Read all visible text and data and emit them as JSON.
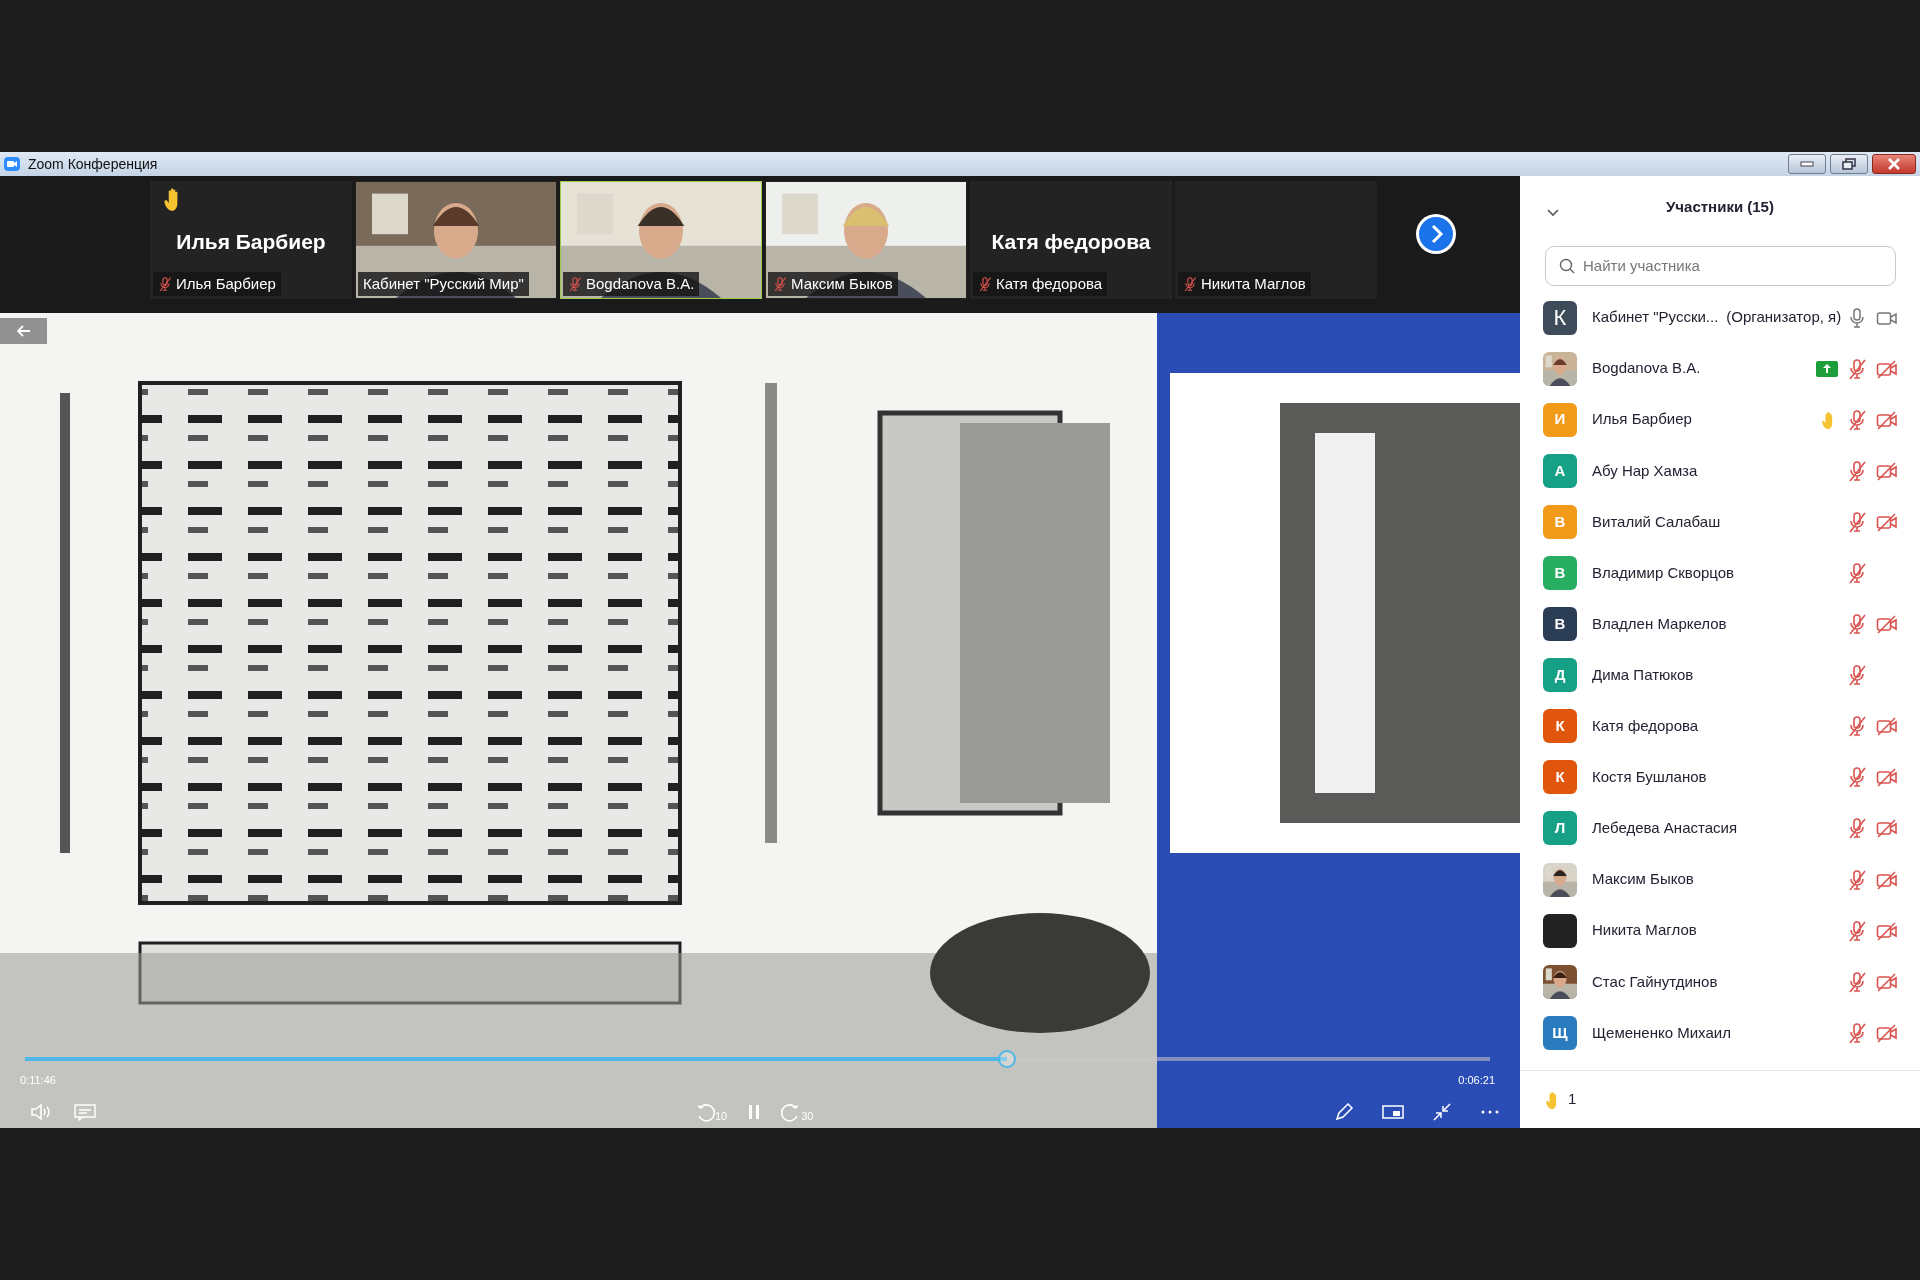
{
  "window": {
    "title": "Zoom Конференция"
  },
  "thumbnails": [
    {
      "kind": "name",
      "name": "Илья Барбиер",
      "label": "Илья Барбиер",
      "muted": true,
      "hand": true,
      "highlighted": false
    },
    {
      "kind": "video",
      "label": "Кабинет \"Русский Мир\"",
      "muted": false,
      "hand": false,
      "highlighted": false
    },
    {
      "kind": "video",
      "label": "Bogdanova B.A.",
      "muted": true,
      "hand": false,
      "highlighted": true
    },
    {
      "kind": "video",
      "label": "Максим Быков",
      "muted": true,
      "hand": false,
      "highlighted": false
    },
    {
      "kind": "name",
      "name": "Катя федорова",
      "label": "Катя федорова",
      "muted": true,
      "hand": false,
      "highlighted": false
    },
    {
      "kind": "name",
      "label": "Никита Маглов",
      "muted": true,
      "hand": false,
      "highlighted": false
    }
  ],
  "player": {
    "progress": {
      "level": 0.67
    },
    "elapsed": "0:11:46",
    "remaining": "0:06:21",
    "rewind": "10",
    "forward": "30"
  },
  "panel": {
    "title": "Участники (15)",
    "search": {
      "placeholder": "Найти участника"
    },
    "participants": [
      {
        "name": "Кабинет \"Русски...",
        "role": "(Организатор, я)",
        "avatar": {
          "kind": "letter",
          "letter": "К",
          "color": "#3e4c59"
        },
        "sharing": false,
        "hand_raised": false,
        "mic_muted": false,
        "camera_off": false
      },
      {
        "name": "Bogdanova B.A.",
        "sharing": true,
        "hand_raised": false,
        "mic_muted": true,
        "camera_off": true
      },
      {
        "name": "Илья Барбиер",
        "avatar": {
          "kind": "letter",
          "letter": "И",
          "color": "#f29a1a"
        },
        "sharing": false,
        "hand_raised": true,
        "mic_muted": true,
        "camera_off": true
      },
      {
        "name": "Абу Нар Хамза",
        "avatar": {
          "kind": "letter",
          "letter": "А",
          "color": "#16a085"
        },
        "sharing": false,
        "hand_raised": false,
        "mic_muted": true,
        "camera_off": true
      },
      {
        "name": "Виталий Салабаш",
        "avatar": {
          "kind": "letter",
          "letter": "В",
          "color": "#f29a1a"
        },
        "sharing": false,
        "hand_raised": false,
        "mic_muted": true,
        "camera_off": true
      },
      {
        "name": "Владимир Скворцов",
        "avatar": {
          "kind": "letter",
          "letter": "В",
          "color": "#27ae60"
        },
        "sharing": false,
        "hand_raised": false,
        "mic_muted": true
      },
      {
        "name": "Владлен Маркелов",
        "avatar": {
          "kind": "letter",
          "letter": "В",
          "color": "#2c3e56"
        },
        "sharing": false,
        "hand_raised": false,
        "mic_muted": true,
        "camera_off": true
      },
      {
        "name": "Дима Патюков",
        "avatar": {
          "kind": "letter",
          "letter": "Д",
          "color": "#16a085"
        },
        "sharing": false,
        "hand_raised": false,
        "mic_muted": true
      },
      {
        "name": "Катя федорова",
        "avatar": {
          "kind": "letter",
          "letter": "К",
          "color": "#e0560c"
        },
        "sharing": false,
        "hand_raised": false,
        "mic_muted": true,
        "camera_off": true
      },
      {
        "name": "Костя Бушланов",
        "avatar": {
          "kind": "letter",
          "letter": "К",
          "color": "#e0560c"
        },
        "sharing": false,
        "hand_raised": false,
        "mic_muted": true,
        "camera_off": true
      },
      {
        "name": "Лебедева Анастасия",
        "avatar": {
          "kind": "letter",
          "letter": "Л",
          "color": "#16a085"
        },
        "sharing": false,
        "hand_raised": false,
        "mic_muted": true,
        "camera_off": true
      },
      {
        "name": "Максим Быков",
        "sharing": false,
        "hand_raised": false,
        "mic_muted": true,
        "camera_off": true
      },
      {
        "name": "Никита Маглов",
        "avatar": {
          "kind": "blank",
          "color": "#222222"
        },
        "sharing": false,
        "hand_raised": false,
        "mic_muted": true,
        "camera_off": true
      },
      {
        "name": "Стас Гайнутдинов",
        "sharing": false,
        "hand_raised": false,
        "mic_muted": true,
        "camera_off": true
      },
      {
        "name": "Щемененко Михаил",
        "avatar": {
          "kind": "letter",
          "letter": "Щ",
          "color": "#2b7bbf"
        },
        "sharing": false,
        "hand_raised": false,
        "mic_muted": true,
        "camera_off": true
      }
    ],
    "raised_hands": "1"
  }
}
